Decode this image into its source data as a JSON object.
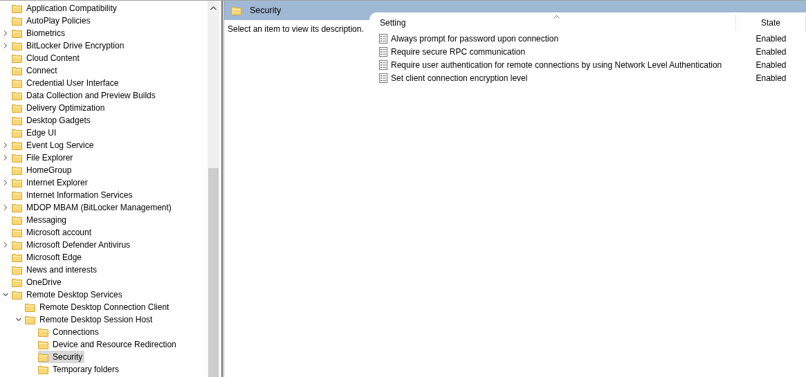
{
  "tree": [
    {
      "label": "Application Compatibility",
      "kind": "leaf",
      "selected": false
    },
    {
      "label": "AutoPlay Policies",
      "kind": "leaf",
      "selected": false
    },
    {
      "label": "Biometrics",
      "kind": "expandable",
      "expanded": false,
      "selected": false
    },
    {
      "label": "BitLocker Drive Encryption",
      "kind": "expandable",
      "expanded": false,
      "selected": false
    },
    {
      "label": "Cloud Content",
      "kind": "leaf",
      "selected": false
    },
    {
      "label": "Connect",
      "kind": "leaf",
      "selected": false
    },
    {
      "label": "Credential User Interface",
      "kind": "leaf",
      "selected": false
    },
    {
      "label": "Data Collection and Preview Builds",
      "kind": "leaf",
      "selected": false
    },
    {
      "label": "Delivery Optimization",
      "kind": "leaf",
      "selected": false
    },
    {
      "label": "Desktop Gadgets",
      "kind": "leaf",
      "selected": false
    },
    {
      "label": "Edge UI",
      "kind": "leaf",
      "selected": false
    },
    {
      "label": "Event Log Service",
      "kind": "expandable",
      "expanded": false,
      "selected": false
    },
    {
      "label": "File Explorer",
      "kind": "expandable",
      "expanded": false,
      "selected": false
    },
    {
      "label": "HomeGroup",
      "kind": "leaf",
      "selected": false
    },
    {
      "label": "Internet Explorer",
      "kind": "expandable",
      "expanded": false,
      "selected": false
    },
    {
      "label": "Internet Information Services",
      "kind": "leaf",
      "selected": false
    },
    {
      "label": "MDOP MBAM (BitLocker Management)",
      "kind": "expandable",
      "expanded": false,
      "selected": false
    },
    {
      "label": "Messaging",
      "kind": "leaf",
      "selected": false
    },
    {
      "label": "Microsoft account",
      "kind": "leaf",
      "selected": false
    },
    {
      "label": "Microsoft Defender Antivirus",
      "kind": "expandable",
      "expanded": false,
      "selected": false
    },
    {
      "label": "Microsoft Edge",
      "kind": "leaf",
      "selected": false
    },
    {
      "label": "News and interests",
      "kind": "leaf",
      "selected": false
    },
    {
      "label": "OneDrive",
      "kind": "leaf",
      "selected": false
    },
    {
      "label": "Remote Desktop Services",
      "kind": "expandable",
      "expanded": true,
      "selected": false,
      "children": [
        {
          "label": "Remote Desktop Connection Client",
          "kind": "leaf",
          "selected": false
        },
        {
          "label": "Remote Desktop Session Host",
          "kind": "expandable",
          "expanded": true,
          "selected": false,
          "children": [
            {
              "label": "Connections",
              "kind": "leaf",
              "selected": false
            },
            {
              "label": "Device and Resource Redirection",
              "kind": "leaf",
              "selected": false
            },
            {
              "label": "Security",
              "kind": "leaf",
              "selected": true
            },
            {
              "label": "Temporary folders",
              "kind": "leaf",
              "selected": false
            }
          ]
        }
      ]
    }
  ],
  "pane_title": "Security",
  "description": "Select an item to view its description.",
  "table": {
    "columns": [
      "Setting",
      "State"
    ],
    "rows": [
      {
        "setting": "Always prompt for password upon connection",
        "state": "Enabled"
      },
      {
        "setting": "Require secure RPC communication",
        "state": "Enabled"
      },
      {
        "setting": "Require user authentication for remote connections by using Network Level Authentication",
        "state": "Enabled"
      },
      {
        "setting": "Set client connection encryption level",
        "state": "Enabled"
      }
    ]
  }
}
